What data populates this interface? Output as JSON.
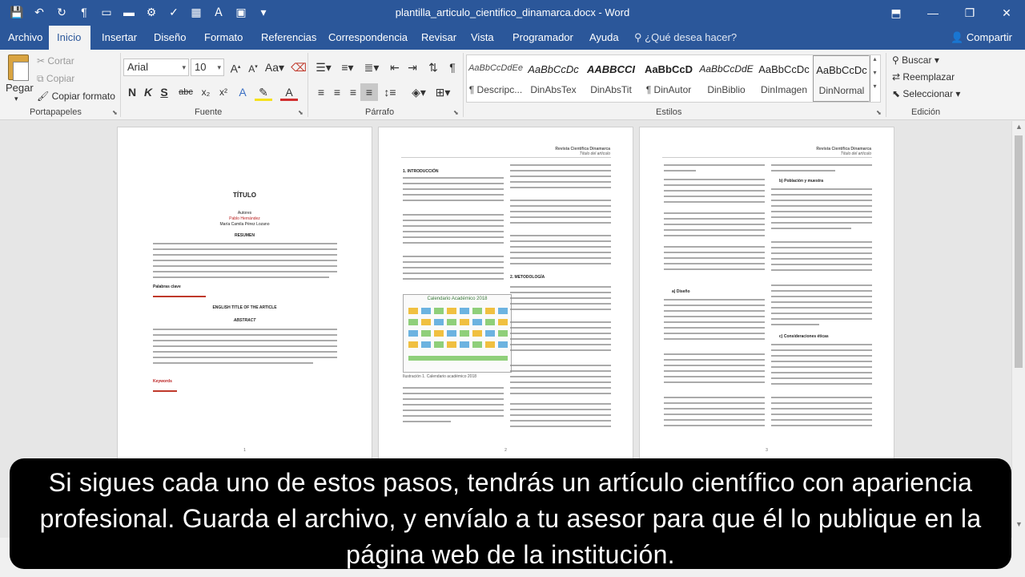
{
  "title_bar": {
    "document_title": "plantilla_articulo_cientifico_dinamarca.docx  -  Word",
    "qat_icons": [
      "save-icon",
      "undo-icon",
      "redo-icon",
      "paragraph-mark-icon",
      "print-preview-icon",
      "open-folder-icon",
      "settings-icon",
      "check-icon",
      "table-icon",
      "textbox-icon",
      "screen-icon",
      "customize-icon"
    ]
  },
  "ribbon_tabs": [
    "Archivo",
    "Inicio",
    "Insertar",
    "Diseño",
    "Formato",
    "Referencias",
    "Correspondencia",
    "Revisar",
    "Vista",
    "Programador",
    "Ayuda"
  ],
  "active_tab": "Inicio",
  "tell_me": "¿Qué desea hacer?",
  "share": "Compartir",
  "clipboard": {
    "paste": "Pegar",
    "cut": "Cortar",
    "copy": "Copiar",
    "format_painter": "Copiar formato",
    "label": "Portapapeles"
  },
  "font": {
    "family": "Arial",
    "size": "10",
    "label": "Fuente"
  },
  "paragraph": {
    "label": "Párrafo"
  },
  "styles": {
    "label": "Estilos",
    "items": [
      {
        "sample": "AaBbCcDdEe",
        "name": "¶ Descripc..."
      },
      {
        "sample": "AaBbCcDc",
        "name": "DinAbsTex"
      },
      {
        "sample": "AABBCCI",
        "name": "DinAbsTit"
      },
      {
        "sample": "AaBbCcD",
        "name": "¶ DinAutor"
      },
      {
        "sample": "AaBbCcDdE",
        "name": "DinBiblio"
      },
      {
        "sample": "AaBbCcDc",
        "name": "DinImagen"
      },
      {
        "sample": "AaBbCcDc",
        "name": "DinNormal"
      }
    ]
  },
  "editing": {
    "find": "Buscar",
    "replace": "Reemplazar",
    "select": "Seleccionar",
    "label": "Edición"
  },
  "pages": {
    "p1": {
      "title": "TÍTULO",
      "authors_label": "Autores",
      "author_1": "Pablo Hernández",
      "author_2": "María Camila Pérez Lozano",
      "resumen": "RESUMEN",
      "keywords_es": "Palabras clave",
      "english_title": "ENGLISH TITLE OF THE ARTICLE",
      "abstract": "ABSTRACT",
      "keywords_en": "Keywords",
      "page_number": "1"
    },
    "p2": {
      "header_1": "Revista Científica Dinamarca",
      "header_2": "Título del artículo",
      "h_intro": "1.  INTRODUCCIÓN",
      "h_method": "2.  METODOLOGÍA",
      "figure_title": "Calendario Académico 2018",
      "figure_caption": "Ilustración 1. Calendario académico 2018",
      "page_number": "2"
    },
    "p3": {
      "header_1": "Revista Científica Dinamarca",
      "header_2": "Título del artículo",
      "h_b": "b)  Población y muestra",
      "h_a": "a)  Diseño",
      "h_c": "c)  Consideraciones éticas",
      "page_number": "3"
    }
  },
  "caption": "Si sigues cada uno de estos pasos, tendrás un artículo científico con apariencia profesional. Guarda el archivo, y envíalo a tu asesor para que él lo publique en la página web de la institución."
}
